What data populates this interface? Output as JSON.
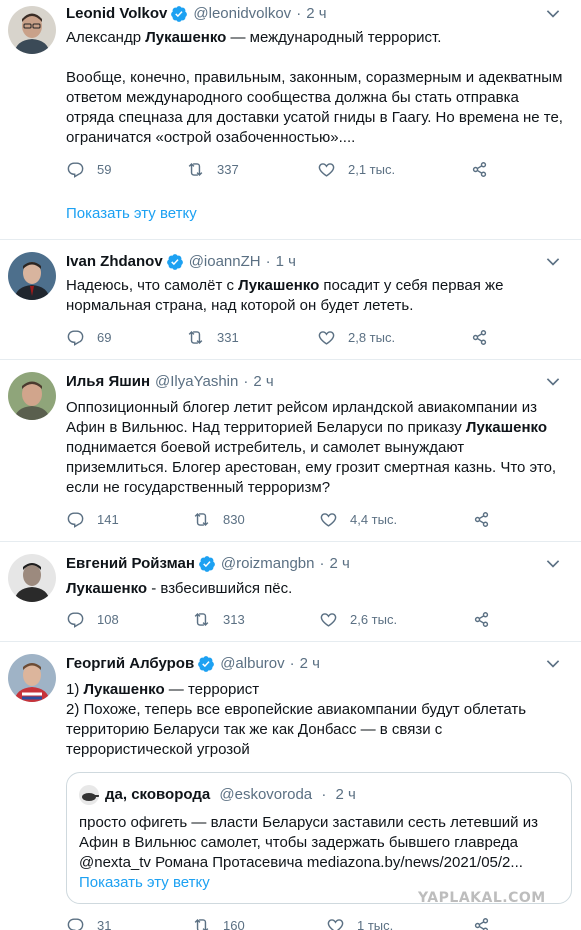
{
  "colors": {
    "link": "#1da1f2",
    "muted": "#5b7083",
    "verified": "#1da1f2",
    "border": "#e6ecf0"
  },
  "tweets": [
    {
      "name": "Leonid Volkov",
      "verified": true,
      "handle": "@leonidvolkov",
      "dot": "·",
      "time": "2 ч",
      "text": [
        {
          "pre": "Александр ",
          "bold": "Лукашенко",
          "post": " — международный террорист."
        },
        {
          "pre": "Вообще, конечно, правильным, законным, соразмерным и адекватным ответом международного сообщества должна бы стать отправка отряда спецназа для доставки усатой гниды в Гаагу. Но времена не те, ограничатся «острой озабоченностью»....",
          "bold": "",
          "post": ""
        }
      ],
      "replies": "59",
      "retweets": "337",
      "likes": "2,1 тыс.",
      "show_thread": "Показать эту ветку"
    },
    {
      "name": "Ivan Zhdanov",
      "verified": true,
      "handle": "@ioannZH",
      "dot": "·",
      "time": "1 ч",
      "text": [
        {
          "pre": "Надеюсь, что самолёт с ",
          "bold": "Лукашенко",
          "post": " посадит у себя первая же нормальная страна, над которой он будет лететь."
        }
      ],
      "replies": "69",
      "retweets": "331",
      "likes": "2,8 тыс."
    },
    {
      "name": "Илья Яшин",
      "verified": false,
      "handle": "@IlyaYashin",
      "dot": "·",
      "time": "2 ч",
      "text": [
        {
          "pre": "Оппозиционный блогер летит рейсом ирландской авиакомпании из Афин в Вильнюс. Над территорией Беларуси по приказу ",
          "bold": "Лукашенко",
          "post": " поднимается боевой истребитель, и самолет вынуждают приземлиться. Блогер арестован, ему грозит смертная казнь. Что это, если не государственный терроризм?"
        }
      ],
      "replies": "141",
      "retweets": "830",
      "likes": "4,4 тыс."
    },
    {
      "name": "Евгений Ройзман",
      "verified": true,
      "handle": "@roizmangbn",
      "dot": "·",
      "time": "2 ч",
      "text": [
        {
          "pre": "",
          "bold": "Лукашенко",
          "post": " - взбесившийся пёс."
        }
      ],
      "replies": "108",
      "retweets": "313",
      "likes": "2,6 тыс."
    },
    {
      "name": "Георгий Албуров",
      "verified": true,
      "handle": "@alburov",
      "dot": "·",
      "time": "2 ч",
      "text": [
        {
          "pre": "1) ",
          "bold": "Лукашенко",
          "post": " — террорист"
        },
        {
          "pre": "2) Похоже, теперь все европейские авиакомпании будут облетать территорию Беларуси так же как Донбасс — в связи с террористической угрозой",
          "bold": "",
          "post": ""
        }
      ],
      "replies": "31",
      "retweets": "160",
      "likes": "1 тыс.",
      "quote": {
        "name": "да, сковорода",
        "handle": "@eskovoroda",
        "dot": "·",
        "time": "2 ч",
        "text": "просто офигеть — власти Беларуси заставили сесть летевший из Афин в Вильнюс самолет, чтобы задержать бывшего главреда @nexta_tv Романа Протасевича mediazona.by/news/2021/05/2...",
        "show_thread": "Показать эту ветку"
      }
    }
  ],
  "watermark": "YAPLAKAL.COM"
}
